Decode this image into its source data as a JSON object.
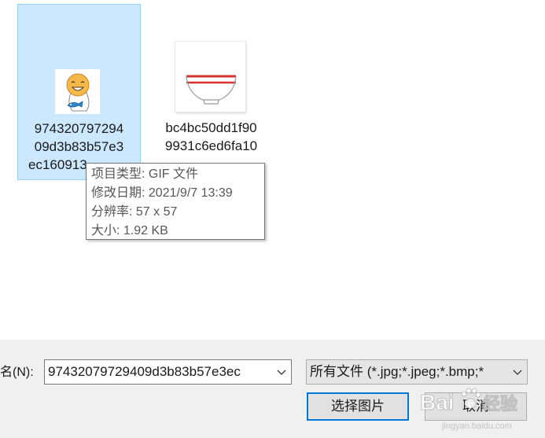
{
  "files": [
    {
      "name_lines": [
        "974320797294",
        "09d3b83b57e3",
        "ec160913"
      ],
      "selected": true,
      "thumbnail": "cartoon-character-thumbnail"
    },
    {
      "name_lines": [
        "bc4bc50dd1f90",
        "9931c6ed6fa10"
      ],
      "selected": false,
      "thumbnail": "bowl-thumbnail"
    }
  ],
  "tooltip": {
    "type_line": "项目类型: GIF 文件",
    "modified_line": "修改日期: 2021/9/7 13:39",
    "resolution_line": "分辨率: 57 x 57",
    "size_line": "大小: 1.92 KB"
  },
  "bottom": {
    "filename_label": "名(N):",
    "filename_value": "97432079729409d3b83b57e3ec",
    "filter_value": "所有文件 (*.jpg;*.jpeg;*.bmp;*",
    "open_button": "选择图片",
    "cancel_button": "取消"
  },
  "watermark": {
    "text": "Bai",
    "suffix": "经验",
    "url": "jingyan.baidu.com"
  },
  "colors": {
    "selection_fill": "#cce8ff",
    "selection_border": "#99d1ff",
    "bottom_bar": "#f0f0f0",
    "focus_blue": "#0078d7",
    "bowl_red": "#d9302f"
  }
}
